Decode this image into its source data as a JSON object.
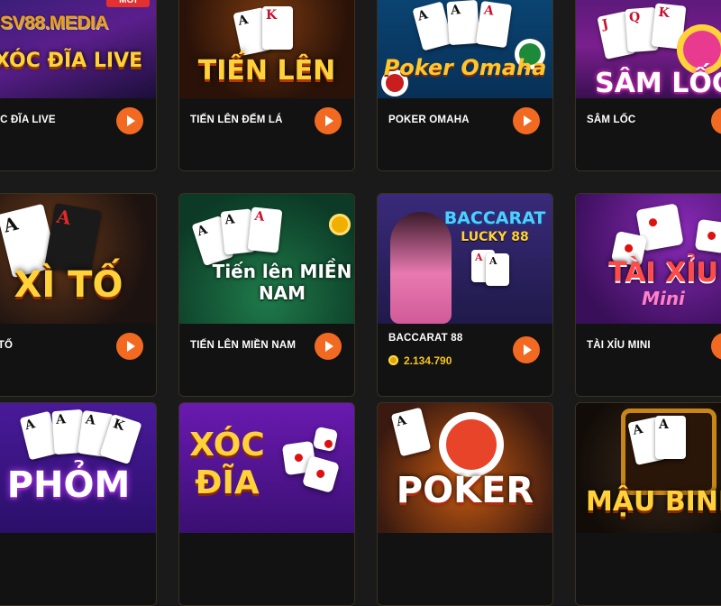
{
  "brand": "SV88.MEDIA",
  "badge_new": "MỚI",
  "accent_color": "#f26a21",
  "jackpot_color": "#f5c518",
  "cards": [
    {
      "name": "ÓC ĐĨA LIVE",
      "art": "XÓC ĐĨA LIVE"
    },
    {
      "name": "TIẾN LÊN ĐẾM LÁ",
      "art": "TIẾN LÊN"
    },
    {
      "name": "POKER OMAHA",
      "art": "Poker Omaha"
    },
    {
      "name": "SÂM LỐC",
      "art": "SÂM LỐC"
    },
    {
      "name": "Ì TỐ",
      "art": "XÌ TỐ"
    },
    {
      "name": "TIẾN LÊN MIỀN NAM",
      "art": "Tiến lên MIỀN NAM"
    },
    {
      "name": "BACCARAT 88",
      "art": "BACCARAT",
      "art_sub": "LUCKY 88",
      "jackpot": "2.134.790"
    },
    {
      "name": "TÀI XỈU MINI",
      "art": "TÀI XỈU",
      "art_sub": "Mini"
    },
    {
      "name": "",
      "art": "PHỎM"
    },
    {
      "name": "",
      "art": "XÓC",
      "art_sub": "ĐĨA"
    },
    {
      "name": "",
      "art": "POKER"
    },
    {
      "name": "",
      "art": "MẬU BINH"
    }
  ]
}
